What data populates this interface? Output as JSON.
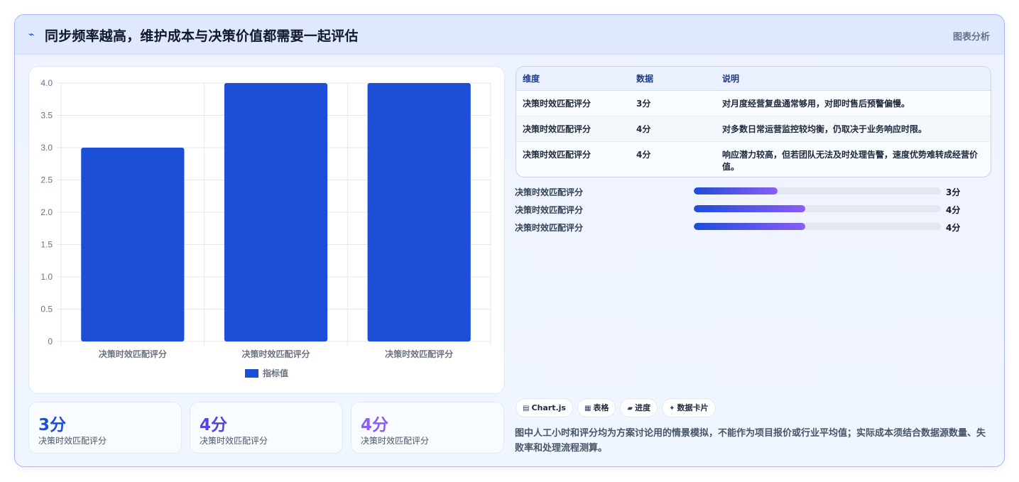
{
  "header": {
    "icon": "chart-line-icon",
    "logo_glyph": "⌁",
    "title": "同步频率越高，维护成本与决策价值都需要一起评估",
    "tag": "图表分析"
  },
  "chart_data": {
    "type": "bar",
    "categories": [
      "决策时效匹配评分",
      "决策时效匹配评分",
      "决策时效匹配评分"
    ],
    "series": [
      {
        "name": "指标值",
        "values": [
          3,
          4,
          4
        ],
        "color": "#1d4ed8"
      }
    ],
    "yticks": [
      "0",
      "0.5",
      "1.0",
      "1.5",
      "2.0",
      "2.5",
      "3.0",
      "3.5",
      "4.0"
    ],
    "ylim": [
      0,
      4
    ],
    "grid": true,
    "legend": "bottom"
  },
  "stats": [
    {
      "value": "3分",
      "label": "决策时效匹配评分",
      "color": "#1d4ed8"
    },
    {
      "value": "4分",
      "label": "决策时效匹配评分",
      "color": "#4f46e5"
    },
    {
      "value": "4分",
      "label": "决策时效匹配评分",
      "color": "#8b5cf6"
    }
  ],
  "table": {
    "headers": [
      "维度",
      "数据",
      "说明"
    ],
    "rows": [
      [
        "决策时效匹配评分",
        "3分",
        "对月度经营复盘通常够用，对即时售后预警偏慢。"
      ],
      [
        "决策时效匹配评分",
        "4分",
        "对多数日常运营监控较均衡，仍取决于业务响应时限。"
      ],
      [
        "决策时效匹配评分",
        "4分",
        "响应潜力较高，但若团队无法及时处理告警，速度优势难转成经营价值。"
      ]
    ]
  },
  "progress": [
    {
      "label": "决策时效匹配评分",
      "value": "3分",
      "fraction": 0.34
    },
    {
      "label": "决策时效匹配评分",
      "value": "4分",
      "fraction": 0.45
    },
    {
      "label": "决策时效匹配评分",
      "value": "4分",
      "fraction": 0.45
    }
  ],
  "chips": [
    {
      "icon": "chart-icon",
      "glyph": "▤",
      "label": "Chart.js"
    },
    {
      "icon": "table-icon",
      "glyph": "▦",
      "label": "表格"
    },
    {
      "icon": "progress-icon",
      "glyph": "▰",
      "label": "进度"
    },
    {
      "icon": "sparkle-icon",
      "glyph": "✦",
      "label": "数据卡片"
    }
  ],
  "note": "图中人工小时和评分均为方案讨论用的情景模拟，不能作为项目报价或行业平均值；实际成本须结合数据源数量、失败率和处理流程测算。"
}
